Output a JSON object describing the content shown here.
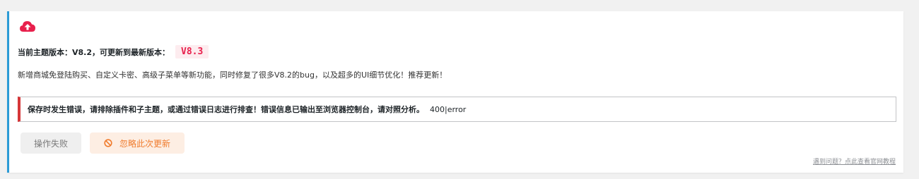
{
  "notice": {
    "icon": "cloud-upload-icon",
    "version_label": "当前主题版本：V8.2，可更新到最新版本：",
    "latest_version": "V8.3",
    "description": "新增商城免登陆购买、自定义卡密、高级子菜单等新功能，同时修复了很多V8.2的bug，以及超多的UI细节优化！推荐更新！"
  },
  "error": {
    "message": "保存时发生错误，请排除插件和子主题，或通过错误日志进行排查！错误信息已输出至浏览器控制台，请对照分析。",
    "code": "400|error"
  },
  "actions": {
    "fail_label": "操作失败",
    "ignore_label": "忽略此次更新",
    "ignore_icon": "ban-icon"
  },
  "help_link": "遇到问题？点此查看官网教程",
  "colors": {
    "accent_border": "#2c9bd6",
    "cloud_icon": "#e8204c",
    "version_badge_text": "#e8204c",
    "version_badge_bg": "#fdecef",
    "error_border": "#d63638",
    "ignore_text": "#f07b2c",
    "ignore_bg": "#fdeee3"
  }
}
